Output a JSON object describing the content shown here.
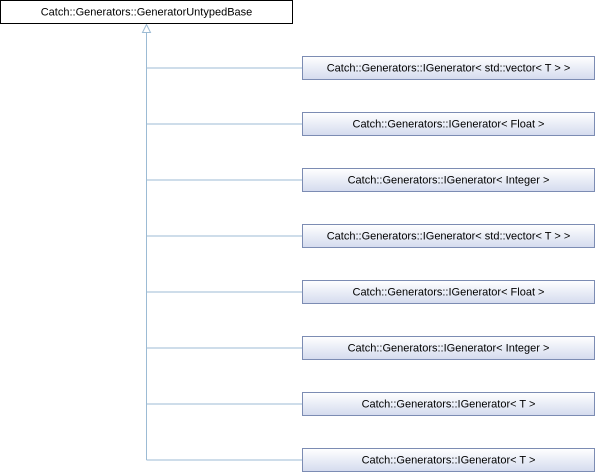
{
  "diagram": {
    "base_class": {
      "label": "Catch::Generators::GeneratorUntypedBase"
    },
    "derived_classes": [
      {
        "label": "Catch::Generators::IGenerator< std::vector< T > >"
      },
      {
        "label": "Catch::Generators::IGenerator< Float >"
      },
      {
        "label": "Catch::Generators::IGenerator< Integer >"
      },
      {
        "label": "Catch::Generators::IGenerator< std::vector< T > >"
      },
      {
        "label": "Catch::Generators::IGenerator< Float >"
      },
      {
        "label": "Catch::Generators::IGenerator< Integer >"
      },
      {
        "label": "Catch::Generators::IGenerator< T >"
      },
      {
        "label": "Catch::Generators::IGenerator< T >"
      }
    ],
    "colors": {
      "base_fill": "#ffffff",
      "base_border": "#000000",
      "derived_fill_top": "#ffffff",
      "derived_fill_bottom": "#d4dbee",
      "derived_border": "#7c8cb3",
      "edge": "#9cbbd4"
    }
  }
}
